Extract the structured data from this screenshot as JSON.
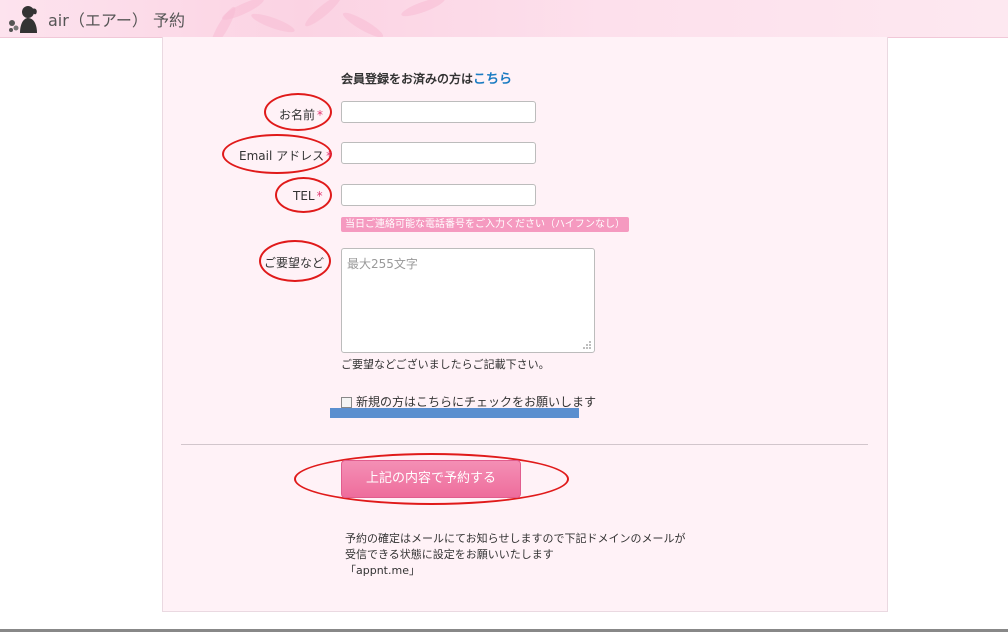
{
  "header": {
    "title": "air（エアー） 予約"
  },
  "form": {
    "member_prompt": "会員登録をお済みの方は",
    "member_link": "こちら",
    "fields": {
      "name_label": "お名前",
      "email_label": "Email アドレス",
      "tel_label": "TEL",
      "required_mark": "*",
      "tel_hint": "当日ご連絡可能な電話番号をご入力ください（ハイフンなし）"
    },
    "request": {
      "label": "ご要望など",
      "placeholder": "最大255文字",
      "note": "ご要望などございましたらご記載下さい。"
    },
    "new_customer_checkbox": {
      "label": "新規の方はこちらにチェックをお願いします",
      "checked": false
    },
    "submit_label": "上記の内容で予約する"
  },
  "footer": {
    "line1": "予約の確定はメールにてお知らせしますので下記ドメインのメールが",
    "line2": "受信できる状態に設定をお願いいたします",
    "line3": "「appnt.me」"
  },
  "colors": {
    "accent_pink": "#ee6d9c",
    "annotation_red": "#e01a1a",
    "annotation_blue": "#5b8fcf",
    "link_blue": "#1a7bc2"
  },
  "icons": {
    "logo": "woman-silhouette-flower-icon",
    "resize": "resize-grip-icon"
  }
}
